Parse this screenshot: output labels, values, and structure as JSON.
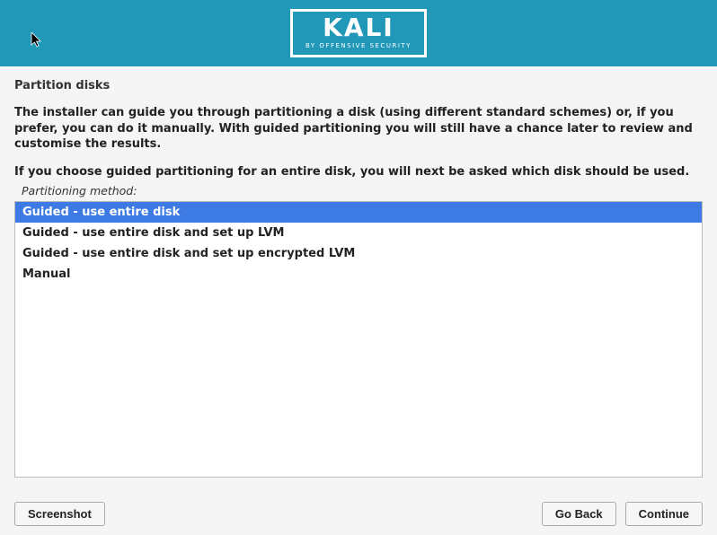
{
  "header": {
    "logo": "KALI",
    "tagline": "BY OFFENSIVE SECURITY"
  },
  "page": {
    "title": "Partition disks",
    "instruction_main": "The installer can guide you through partitioning a disk (using different standard schemes) or, if you prefer, you can do it manually. With guided partitioning you will still have a chance later to review and customise the results.",
    "instruction_sub": "If you choose guided partitioning for an entire disk, you will next be asked which disk should be used.",
    "field_label": "Partitioning method:"
  },
  "options": [
    {
      "label": "Guided - use entire disk",
      "selected": true
    },
    {
      "label": "Guided - use entire disk and set up LVM",
      "selected": false
    },
    {
      "label": "Guided - use entire disk and set up encrypted LVM",
      "selected": false
    },
    {
      "label": "Manual",
      "selected": false
    }
  ],
  "buttons": {
    "screenshot": "Screenshot",
    "goback": "Go Back",
    "continue": "Continue"
  }
}
